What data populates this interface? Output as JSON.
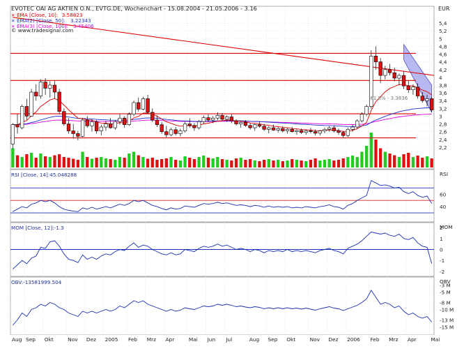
{
  "chart_data": {
    "type": "candlestick",
    "currency_label": "EUR",
    "title": "EVOTEC OAI AG AKTIEN O.N., EVTG.DE, Wochenchart - 15.08.2004 - 21.05.2006 - 3.16",
    "source": "© www.tradesignal.com",
    "x_tick_labels": [
      "Aug",
      "Sep",
      "Okt",
      "Nov",
      "Dez",
      "2005",
      "Feb",
      "Mrz",
      "Apr",
      "Mai",
      "Jun",
      "Jul",
      "Aug",
      "Sep",
      "Okt",
      "Nov",
      "Dez",
      "2006",
      "Feb",
      "Mrz",
      "Apr",
      "Mai"
    ],
    "x_tick_week_index": [
      0,
      3,
      7,
      12,
      16,
      20,
      25,
      29,
      33,
      38,
      42,
      46,
      51,
      55,
      59,
      64,
      68,
      72,
      77,
      81,
      85,
      90
    ],
    "price_panel": {
      "ylim": [
        2.0,
        5.6
      ],
      "y_ticks": [
        2.2,
        2.4,
        2.6,
        2.8,
        3.0,
        3.2,
        3.4,
        3.6,
        3.8,
        4.0,
        4.2,
        4.4,
        4.6,
        4.8,
        5.0,
        5.2,
        5.4
      ],
      "y_tick_labels": [
        "2,2",
        "2,4",
        "2,6",
        "2,8",
        "3",
        "3,2",
        "3,4",
        "3,6",
        "3,8",
        "4",
        "4,2",
        "4,4",
        "4,6",
        "4,8",
        "5",
        "5,2",
        "5,4"
      ],
      "legend": [
        {
          "label": "EMA [Close, 10]:",
          "value": "3.58823",
          "color": "#dd0000"
        },
        {
          "label": "EMA(2) [Close, 50]:",
          "value": "3.22343",
          "color": "#2233cc"
        },
        {
          "label": "EMA(3) [Close, 100]:",
          "value": "3.45406",
          "color": "#dd00dd"
        }
      ],
      "annotation": "61.8% - 3.3836",
      "horizontal_lines": [
        4.62,
        3.92,
        3.06,
        2.44
      ],
      "downtrend_line": {
        "start": [
          0,
          5.55
        ],
        "end": [
          91,
          4.05
        ]
      },
      "channel": {
        "start_week": 84,
        "end_week": 91,
        "upper_start": 4.85,
        "upper_end": 3.8,
        "lower_start": 4.45,
        "lower_end": 3.1
      }
    },
    "weeks": 91,
    "ohlc": [
      [
        2.28,
        2.82,
        2.16,
        2.78
      ],
      [
        2.78,
        3.05,
        2.55,
        2.72
      ],
      [
        2.7,
        3.3,
        2.66,
        3.25
      ],
      [
        3.25,
        3.45,
        2.9,
        3.0
      ],
      [
        3.0,
        3.7,
        2.98,
        3.62
      ],
      [
        3.62,
        3.82,
        3.4,
        3.52
      ],
      [
        3.52,
        3.95,
        3.45,
        3.88
      ],
      [
        3.88,
        3.98,
        3.55,
        3.72
      ],
      [
        3.72,
        3.9,
        3.48,
        3.8
      ],
      [
        3.8,
        3.92,
        3.45,
        3.62
      ],
      [
        3.62,
        3.7,
        3.05,
        3.12
      ],
      [
        3.12,
        3.2,
        2.75,
        2.8
      ],
      [
        2.8,
        2.95,
        2.55,
        2.62
      ],
      [
        2.62,
        2.8,
        2.42,
        2.55
      ],
      [
        2.55,
        2.62,
        2.38,
        2.48
      ],
      [
        2.48,
        2.95,
        2.46,
        2.9
      ],
      [
        2.9,
        3.0,
        2.7,
        2.75
      ],
      [
        2.75,
        2.92,
        2.6,
        2.85
      ],
      [
        2.85,
        2.9,
        2.55,
        2.62
      ],
      [
        2.62,
        2.78,
        2.5,
        2.72
      ],
      [
        2.72,
        2.88,
        2.62,
        2.8
      ],
      [
        2.8,
        2.95,
        2.68,
        2.7
      ],
      [
        2.7,
        2.9,
        2.65,
        2.86
      ],
      [
        2.86,
        3.05,
        2.78,
        2.95
      ],
      [
        2.95,
        3.0,
        2.7,
        2.78
      ],
      [
        2.78,
        3.1,
        2.75,
        3.05
      ],
      [
        3.05,
        3.4,
        3.0,
        3.35
      ],
      [
        3.35,
        3.48,
        3.12,
        3.18
      ],
      [
        3.18,
        3.5,
        3.15,
        3.45
      ],
      [
        3.45,
        3.55,
        3.05,
        3.1
      ],
      [
        3.1,
        3.2,
        2.85,
        2.9
      ],
      [
        2.9,
        3.02,
        2.72,
        2.78
      ],
      [
        2.78,
        2.85,
        2.55,
        2.6
      ],
      [
        2.6,
        2.75,
        2.45,
        2.52
      ],
      [
        2.52,
        2.7,
        2.48,
        2.65
      ],
      [
        2.65,
        2.72,
        2.5,
        2.55
      ],
      [
        2.55,
        2.68,
        2.48,
        2.62
      ],
      [
        2.62,
        2.85,
        2.58,
        2.8
      ],
      [
        2.8,
        2.95,
        2.7,
        2.76
      ],
      [
        2.76,
        2.82,
        2.62,
        2.7
      ],
      [
        2.7,
        2.9,
        2.66,
        2.86
      ],
      [
        2.86,
        3.02,
        2.8,
        2.96
      ],
      [
        2.96,
        3.05,
        2.85,
        2.9
      ],
      [
        2.9,
        3.0,
        2.82,
        2.95
      ],
      [
        2.95,
        3.1,
        2.9,
        3.02
      ],
      [
        3.02,
        3.08,
        2.88,
        2.92
      ],
      [
        2.92,
        3.02,
        2.85,
        2.98
      ],
      [
        2.98,
        3.05,
        2.82,
        2.88
      ],
      [
        2.88,
        2.92,
        2.76,
        2.8
      ],
      [
        2.8,
        2.88,
        2.7,
        2.84
      ],
      [
        2.84,
        2.9,
        2.72,
        2.76
      ],
      [
        2.76,
        2.82,
        2.65,
        2.7
      ],
      [
        2.7,
        2.8,
        2.62,
        2.78
      ],
      [
        2.78,
        2.86,
        2.7,
        2.74
      ],
      [
        2.74,
        2.8,
        2.62,
        2.66
      ],
      [
        2.66,
        2.74,
        2.56,
        2.7
      ],
      [
        2.7,
        2.78,
        2.62,
        2.64
      ],
      [
        2.64,
        2.72,
        2.58,
        2.68
      ],
      [
        2.68,
        2.74,
        2.58,
        2.62
      ],
      [
        2.62,
        2.7,
        2.55,
        2.66
      ],
      [
        2.66,
        2.72,
        2.58,
        2.6
      ],
      [
        2.6,
        2.66,
        2.52,
        2.63
      ],
      [
        2.63,
        2.68,
        2.54,
        2.58
      ],
      [
        2.58,
        2.66,
        2.52,
        2.62
      ],
      [
        2.62,
        2.7,
        2.56,
        2.6
      ],
      [
        2.6,
        2.66,
        2.5,
        2.56
      ],
      [
        2.56,
        2.64,
        2.5,
        2.62
      ],
      [
        2.62,
        2.7,
        2.56,
        2.66
      ],
      [
        2.66,
        2.74,
        2.6,
        2.7
      ],
      [
        2.7,
        2.76,
        2.58,
        2.62
      ],
      [
        2.62,
        2.68,
        2.52,
        2.58
      ],
      [
        2.58,
        2.62,
        2.44,
        2.5
      ],
      [
        2.5,
        2.7,
        2.46,
        2.66
      ],
      [
        2.66,
        2.78,
        2.6,
        2.72
      ],
      [
        2.72,
        2.92,
        2.68,
        2.88
      ],
      [
        2.88,
        3.1,
        2.84,
        3.05
      ],
      [
        3.05,
        3.3,
        3.0,
        3.25
      ],
      [
        3.25,
        4.7,
        3.2,
        4.55
      ],
      [
        4.55,
        4.8,
        4.2,
        4.4
      ],
      [
        4.4,
        4.5,
        3.85,
        4.05
      ],
      [
        4.05,
        4.3,
        3.95,
        4.2
      ],
      [
        4.2,
        4.35,
        4.05,
        4.12
      ],
      [
        4.12,
        4.25,
        3.9,
        3.98
      ],
      [
        3.98,
        4.1,
        3.8,
        4.05
      ],
      [
        4.05,
        4.15,
        3.7,
        3.78
      ],
      [
        3.78,
        3.92,
        3.6,
        3.68
      ],
      [
        3.68,
        3.82,
        3.55,
        3.75
      ],
      [
        3.75,
        3.85,
        3.45,
        3.52
      ],
      [
        3.52,
        3.62,
        3.35,
        3.4
      ],
      [
        3.4,
        3.55,
        3.25,
        3.45
      ],
      [
        3.45,
        3.5,
        3.1,
        3.16
      ]
    ],
    "volume": [
      0.55,
      0.35,
      0.3,
      0.38,
      0.42,
      0.28,
      0.4,
      0.32,
      0.3,
      0.35,
      0.38,
      0.3,
      0.28,
      0.25,
      0.22,
      0.45,
      0.3,
      0.25,
      0.28,
      0.3,
      0.26,
      0.24,
      0.22,
      0.3,
      0.28,
      0.4,
      0.45,
      0.35,
      0.3,
      0.25,
      0.28,
      0.22,
      0.24,
      0.26,
      0.3,
      0.22,
      0.2,
      0.32,
      0.28,
      0.24,
      0.3,
      0.34,
      0.28,
      0.26,
      0.3,
      0.24,
      0.22,
      0.2,
      0.26,
      0.28,
      0.22,
      0.24,
      0.2,
      0.18,
      0.22,
      0.24,
      0.2,
      0.22,
      0.18,
      0.2,
      0.24,
      0.22,
      0.2,
      0.18,
      0.22,
      0.26,
      0.2,
      0.22,
      0.24,
      0.2,
      0.22,
      0.26,
      0.3,
      0.34,
      0.3,
      0.45,
      0.62,
      1.0,
      0.8,
      0.55,
      0.45,
      0.4,
      0.35,
      0.3,
      0.38,
      0.42,
      0.3,
      0.34,
      0.28,
      0.32,
      0.26
    ],
    "rsi_panel": {
      "legend": "RSI [Close, 14]:45.048288",
      "axis_label": "RSI",
      "ylim": [
        20,
        95
      ],
      "y_ticks": [
        40,
        60
      ],
      "levels": [
        70,
        50,
        30
      ],
      "values": [
        32,
        36,
        40,
        38,
        44,
        46,
        50,
        48,
        50,
        46,
        40,
        36,
        34,
        33,
        32,
        38,
        36,
        39,
        36,
        38,
        40,
        38,
        41,
        44,
        42,
        45,
        50,
        48,
        50,
        46,
        42,
        40,
        37,
        35,
        38,
        36,
        37,
        41,
        40,
        39,
        42,
        45,
        44,
        45,
        47,
        45,
        46,
        44,
        42,
        43,
        42,
        40,
        42,
        41,
        39,
        41,
        39,
        40,
        39,
        40,
        38,
        39,
        38,
        40,
        39,
        38,
        40,
        41,
        43,
        40,
        39,
        36,
        42,
        45,
        50,
        54,
        58,
        82,
        78,
        74,
        75,
        73,
        70,
        71,
        64,
        61,
        64,
        58,
        55,
        57,
        45
      ]
    },
    "mom_panel": {
      "legend": "MOM [Close, 12]:-1.3",
      "axis_label": "MOM",
      "ylim": [
        -2.2,
        2.2
      ],
      "y_ticks": [
        -2,
        -1,
        0,
        1,
        2
      ],
      "y_tick_labels": [
        "-2",
        "-1",
        "0",
        "1",
        "2"
      ],
      "zero_line": 0,
      "values": [
        -1.8,
        -1.4,
        -1.0,
        -1.3,
        -0.8,
        -0.6,
        0.2,
        0.1,
        0.7,
        0.8,
        0.3,
        -0.4,
        -0.9,
        -1.0,
        -1.2,
        -0.5,
        -0.9,
        -0.7,
        -0.9,
        -0.6,
        -0.4,
        -0.5,
        -0.2,
        0.0,
        -0.1,
        0.3,
        0.6,
        0.2,
        0.4,
        0.3,
        0.0,
        -0.2,
        -0.4,
        -0.5,
        -0.3,
        -0.5,
        -0.4,
        0.0,
        -0.1,
        -0.2,
        0.1,
        0.3,
        0.2,
        0.3,
        0.5,
        0.3,
        0.4,
        0.2,
        0.0,
        0.1,
        0.0,
        -0.2,
        0.0,
        -0.1,
        -0.3,
        -0.1,
        -0.2,
        -0.1,
        -0.2,
        0.0,
        -0.2,
        -0.1,
        -0.2,
        -0.1,
        -0.2,
        -0.3,
        -0.1,
        0.0,
        0.1,
        -0.1,
        -0.2,
        -0.4,
        0.1,
        0.3,
        0.5,
        0.8,
        1.2,
        1.6,
        1.5,
        1.4,
        1.5,
        1.3,
        1.2,
        1.4,
        1.0,
        0.9,
        1.1,
        0.6,
        0.3,
        0.2,
        -1.3
      ]
    },
    "obv_panel": {
      "legend": "OBV:-13581999.504",
      "axis_label": "OBV",
      "ylim": [
        -16.5,
        -1.5
      ],
      "y_ticks": [
        -3,
        -5,
        -8,
        -10,
        -13,
        -15
      ],
      "y_tick_labels": [
        "-3 M",
        "-5 M",
        "-8 M",
        "-10 M",
        "-13 M",
        "-15 M"
      ],
      "values": [
        -14.5,
        -13.0,
        -11.0,
        -12.0,
        -10.0,
        -9.5,
        -8.5,
        -9.0,
        -8.0,
        -8.5,
        -9.5,
        -10.0,
        -11.0,
        -11.5,
        -12.0,
        -10.5,
        -11.0,
        -10.5,
        -11.0,
        -10.5,
        -10.0,
        -10.5,
        -10.0,
        -9.0,
        -9.5,
        -8.5,
        -7.5,
        -8.0,
        -7.5,
        -8.5,
        -9.0,
        -9.5,
        -10.0,
        -10.5,
        -10.0,
        -10.5,
        -10.2,
        -9.5,
        -9.8,
        -10.0,
        -9.5,
        -9.0,
        -9.2,
        -9.0,
        -8.5,
        -8.8,
        -8.5,
        -8.8,
        -9.2,
        -9.0,
        -9.3,
        -9.5,
        -9.2,
        -9.4,
        -9.8,
        -9.5,
        -9.8,
        -9.5,
        -9.8,
        -9.5,
        -9.8,
        -9.6,
        -9.9,
        -9.6,
        -9.9,
        -10.2,
        -9.8,
        -9.5,
        -9.2,
        -9.6,
        -9.8,
        -10.3,
        -9.8,
        -9.3,
        -8.8,
        -8.0,
        -7.0,
        -4.5,
        -6.5,
        -8.5,
        -8.0,
        -8.5,
        -9.5,
        -9.0,
        -10.5,
        -11.5,
        -11.0,
        -12.0,
        -12.5,
        -12.0,
        -13.6
      ]
    }
  }
}
